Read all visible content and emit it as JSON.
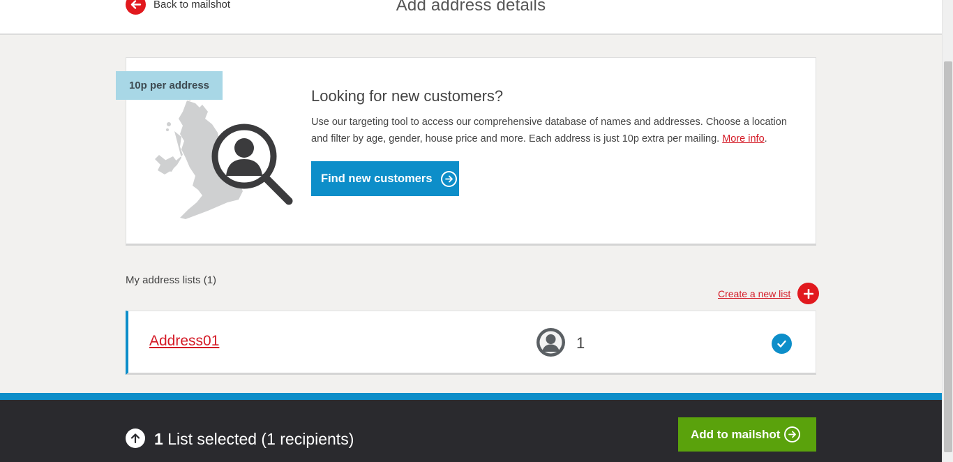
{
  "header": {
    "back_label": "Back to mailshot",
    "title": "Add address details"
  },
  "promo": {
    "price_tag": "10p per address",
    "heading": "Looking for new customers?",
    "description": "Use our targeting tool to access our comprehensive database of names and addresses. Choose a location and filter by age, gender, house price and more. Each address is just 10p extra per mailing.",
    "more_info_link": "More info",
    "description_end": ".",
    "cta_label": "Find new customers"
  },
  "address_lists": {
    "title": "My address lists (1)",
    "create_label": "Create a new list",
    "items": [
      {
        "name": "Address01",
        "recipients": "1",
        "selected": true
      }
    ]
  },
  "footer": {
    "selected_count": "1",
    "selected_text": "List selected (1 recipients)",
    "add_label": "Add to mailshot"
  },
  "colors": {
    "brand_red": "#e1191e",
    "link_red": "#d41a26",
    "accent_blue": "#0d8ec9",
    "action_green": "#5aa20c",
    "footer_dark": "#2a2a2e",
    "price_tag_blue": "#a8d7e6"
  },
  "icons": {
    "back": "arrow-left-circle-icon",
    "cta": "arrow-right-circle-icon",
    "create": "plus-circle-icon",
    "recipient": "user-avatar-icon",
    "selected": "checkmark-circle-icon",
    "toggle": "arrow-up-circle-icon",
    "illustration": "uk-map-magnifier-icon"
  }
}
